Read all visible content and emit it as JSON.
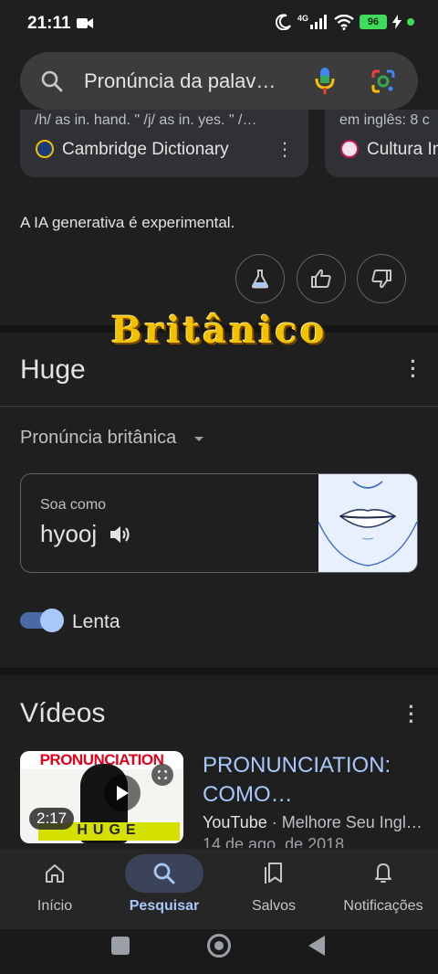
{
  "status_bar": {
    "time": "21:11",
    "network": "4G",
    "battery": "96"
  },
  "search": {
    "query": "Pronúncia da palav…"
  },
  "sources": [
    {
      "snippet": "/h/ as in. hand. \" /j/ as in. yes. \" /…",
      "name": "Cambridge Dictionary"
    },
    {
      "snippet": "em inglês: 8 c",
      "name": "Cultura In"
    }
  ],
  "ai_note": "A IA generativa é experimental.",
  "overlay_title": "Britânico",
  "pronunciation": {
    "word_title": "Huge",
    "selector": "Pronúncia britânica",
    "sounds_like_label": "Soa como",
    "phonetic": "hyooj",
    "slow_label": "Lenta",
    "slow_enabled": true
  },
  "videos": {
    "title": "Vídeos",
    "items": [
      {
        "thumb_banner": "PRONUNCIATION",
        "thumb_word": "HUGE",
        "duration": "2:17",
        "title": "PRONUNCIATION: COMO…",
        "channel": "YouTube",
        "source_suffix": " · Melhore Seu Ingl…",
        "date": "14 de ago. de 2018"
      }
    ]
  },
  "bottom_nav": {
    "items": [
      {
        "label": "Início",
        "icon": "home-icon"
      },
      {
        "label": "Pesquisar",
        "icon": "search-icon"
      },
      {
        "label": "Salvos",
        "icon": "bookmarks-icon"
      },
      {
        "label": "Notificações",
        "icon": "bell-icon"
      }
    ],
    "active": "Pesquisar"
  },
  "colors": {
    "background": "#1f1f1f",
    "accent": "#a8c7fa",
    "overlay_gold": "#f2c200"
  }
}
